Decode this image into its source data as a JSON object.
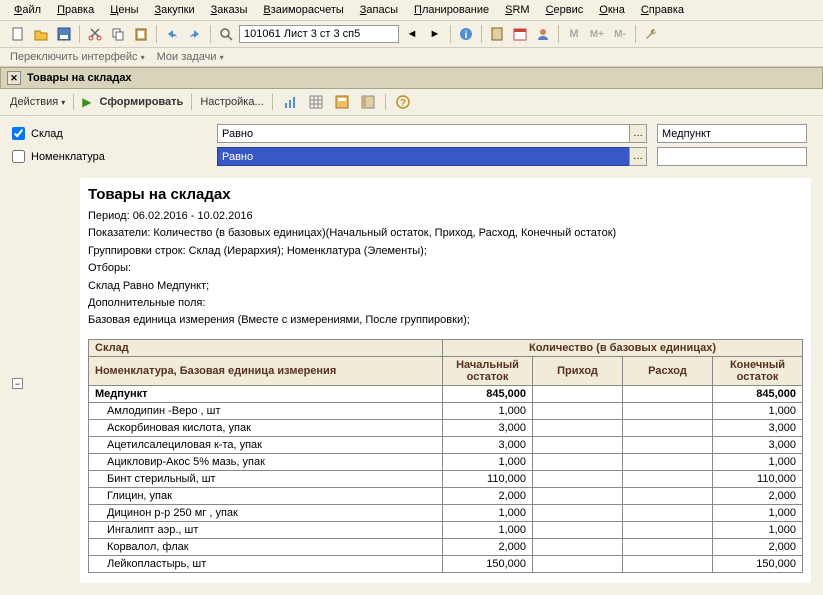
{
  "menu": [
    "Файл",
    "Правка",
    "Цены",
    "Закупки",
    "Заказы",
    "Взаиморасчеты",
    "Запасы",
    "Планирование",
    "SRM",
    "Сервис",
    "Окна",
    "Справка"
  ],
  "toolbar": {
    "location": "101061 Лист 3 ст 3 сп5"
  },
  "switchbar": {
    "switch": "Переключить интерфейс",
    "tasks": "Мои задачи"
  },
  "window_title": "Товары на складах",
  "actions": {
    "actions": "Действия",
    "form": "Сформировать",
    "settings": "Настройка..."
  },
  "filters": {
    "f1_label": "Склад",
    "f1_op": "Равно",
    "f1_val": "Медпункт",
    "f2_label": "Номенклатура",
    "f2_op": "Равно",
    "f2_val": ""
  },
  "report": {
    "title": "Товары на складах",
    "period": "Период: 06.02.2016 - 10.02.2016",
    "indicators": "Показатели: Количество (в базовых единицах)(Начальный остаток, Приход, Расход, Конечный остаток)",
    "grouping": "Группировки строк: Склад (Иерархия); Номенклатура (Элементы);",
    "filters_lbl": "Отборы:",
    "filter_line": "Склад Равно Медпункт;",
    "addl": "Дополнительные поля:",
    "addl_line": "Базовая единица измерения (Вместе с измерениями, После группировки);"
  },
  "headers": {
    "sklad": "Склад",
    "qty": "Количество (в базовых единицах)",
    "nomen": "Номенклатура, Базовая единица измерения",
    "start": "Начальный остаток",
    "in": "Приход",
    "out": "Расход",
    "end": "Конечный остаток"
  },
  "group": {
    "name": "Медпункт",
    "start": "845,000",
    "end": "845,000"
  },
  "rows": [
    {
      "name": "Амлодипин -Веро , шт",
      "start": "1,000",
      "end": "1,000"
    },
    {
      "name": "Аскорбиновая кислота, упак",
      "start": "3,000",
      "end": "3,000"
    },
    {
      "name": "Ацетилсалециловая к-та, упак",
      "start": "3,000",
      "end": "3,000"
    },
    {
      "name": "Ацикловир-Акос 5% мазь, упак",
      "start": "1,000",
      "end": "1,000"
    },
    {
      "name": "Бинт стерильный, шт",
      "start": "110,000",
      "end": "110,000"
    },
    {
      "name": "Глицин, упак",
      "start": "2,000",
      "end": "2,000"
    },
    {
      "name": "Дицинон р-р 250 мг , упак",
      "start": "1,000",
      "end": "1,000"
    },
    {
      "name": "Ингалипт аэр., шт",
      "start": "1,000",
      "end": "1,000"
    },
    {
      "name": "Корвалол, флак",
      "start": "2,000",
      "end": "2,000"
    },
    {
      "name": "Лейкопластырь, шт",
      "start": "150,000",
      "end": "150,000"
    }
  ]
}
